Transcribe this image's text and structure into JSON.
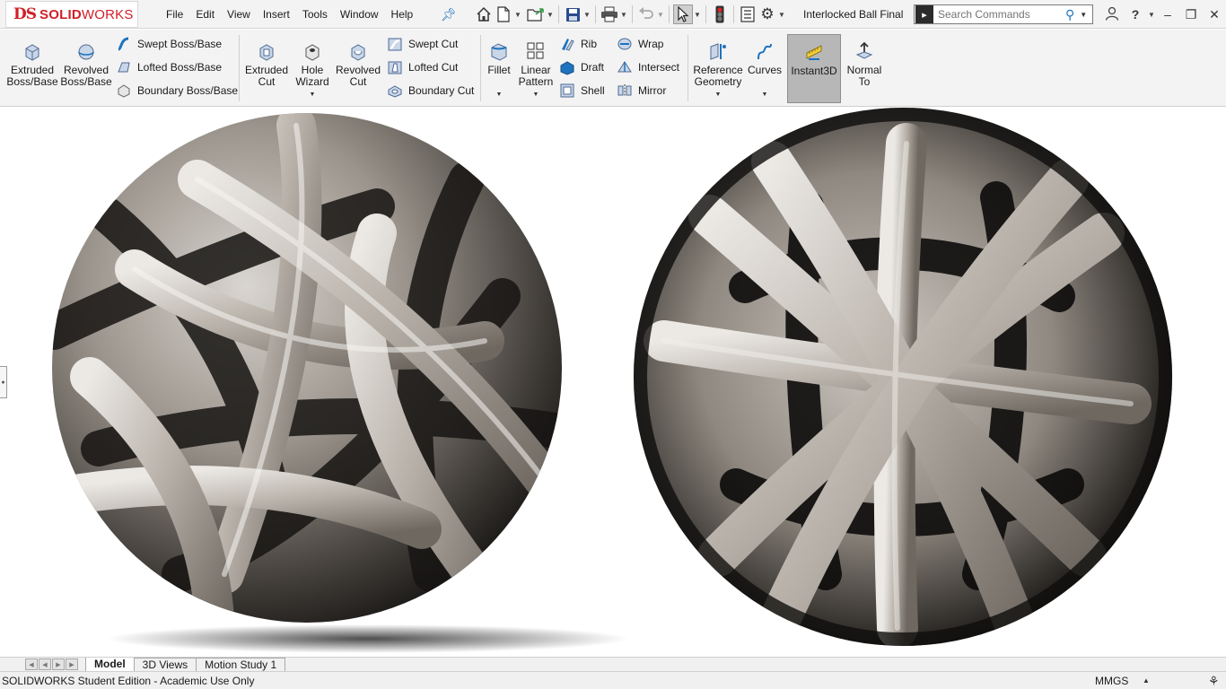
{
  "app": {
    "logo_mark": "DS",
    "logo_text_bold": "SOLID",
    "logo_text_rest": "WORKS",
    "document_title": "Interlocked Ball Final"
  },
  "menu": [
    "File",
    "Edit",
    "View",
    "Insert",
    "Tools",
    "Window",
    "Help"
  ],
  "search": {
    "placeholder": "Search Commands"
  },
  "ribbon": {
    "extruded_boss": "Extruded\nBoss/Base",
    "revolved_boss": "Revolved\nBoss/Base",
    "swept_boss": "Swept Boss/Base",
    "lofted_boss": "Lofted Boss/Base",
    "boundary_boss": "Boundary Boss/Base",
    "extruded_cut": "Extruded\nCut",
    "hole_wizard": "Hole\nWizard",
    "revolved_cut": "Revolved\nCut",
    "swept_cut": "Swept Cut",
    "lofted_cut": "Lofted Cut",
    "boundary_cut": "Boundary Cut",
    "fillet": "Fillet",
    "linear_pattern": "Linear\nPattern",
    "rib": "Rib",
    "draft": "Draft",
    "shell": "Shell",
    "wrap": "Wrap",
    "intersect": "Intersect",
    "mirror": "Mirror",
    "reference_geometry": "Reference\nGeometry",
    "curves": "Curves",
    "instant3d": "Instant3D",
    "normal_to": "Normal\nTo"
  },
  "tabs": [
    "Model",
    "3D Views",
    "Motion Study 1"
  ],
  "active_tab": "Model",
  "status": {
    "text": "SOLIDWORKS Student Edition - Academic Use Only",
    "units": "MMGS"
  },
  "colors": {
    "brand_red": "#d11f26",
    "accent_blue": "#1e73be",
    "ribbon_bg": "#f3f3f3",
    "pressed_button": "#b7b7b7",
    "model_metal": "#b4aca3"
  },
  "icons": [
    "home-icon",
    "new-document-icon",
    "open-icon",
    "save-icon",
    "print-icon",
    "undo-icon",
    "select-icon",
    "traffic-light-icon",
    "file-properties-icon",
    "options-gear-icon",
    "user-icon",
    "help-icon",
    "minimize-icon",
    "restore-icon",
    "close-icon",
    "pin-icon",
    "search-icon"
  ]
}
